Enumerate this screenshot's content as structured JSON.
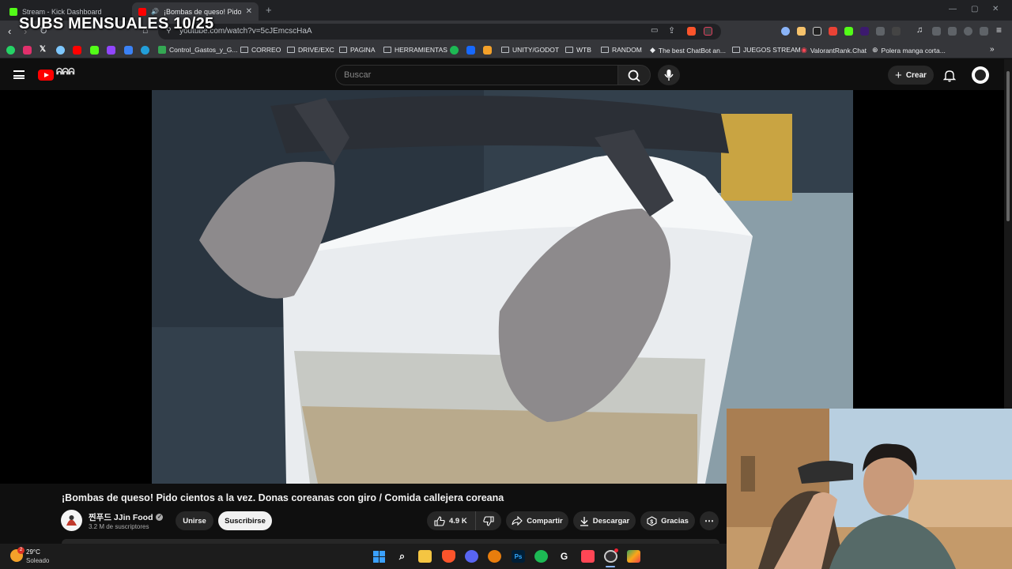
{
  "browser": {
    "tabs": [
      {
        "label": "Stream - Kick Dashboard",
        "favicon_color": "#53fc18"
      },
      {
        "label": "¡Bombas de queso! Pido cien",
        "favicon_color": "#ff0000"
      }
    ],
    "new_tab_icon": "+",
    "url": "youtube.com/watch?v=5cJEmcscHaA",
    "bookmarks": [
      "Control_Gastos_y_G...",
      "CORREO",
      "DRIVE/EXC",
      "PAGINA",
      "HERRAMIENTAS",
      "UNITY/GODOT",
      "WTB",
      "RANDOM",
      "The best ChatBot an...",
      "JUEGOS STREAM",
      "ValorantRank.Chat",
      "Polera manga corta..."
    ],
    "bookmark_icon_colors": [
      "#25d366",
      "#e1306c",
      "#ffffff",
      "#7ec8ff",
      "#ff0000",
      "#53fc18",
      "#9146ff",
      "#3b82f6",
      "#229ed9"
    ]
  },
  "stream_overlay": {
    "text": "SUBS MENSUALES 10/25"
  },
  "youtube": {
    "search_placeholder": "Buscar",
    "create_label": "Crear",
    "video": {
      "title": "¡Bombas de queso! Pido cientos a la vez. Donas coreanas con giro / Comida callejera coreana",
      "channel_name": "찐푸드 JJin Food",
      "subscribers": "3.2 M de suscriptores",
      "join_label": "Unirse",
      "subscribe_label": "Suscribirse",
      "likes": "4.9 K",
      "share_label": "Compartir",
      "download_label": "Descargar",
      "thanks_label": "Gracias"
    }
  },
  "taskbar": {
    "temperature": "29°C",
    "condition": "Soleado",
    "weather_badge": "2",
    "apps": [
      "windows-start",
      "search",
      "file-explorer",
      "brave",
      "discord",
      "blender",
      "photoshop",
      "spotify",
      "steam-like",
      "valorant",
      "obs",
      "app"
    ]
  }
}
